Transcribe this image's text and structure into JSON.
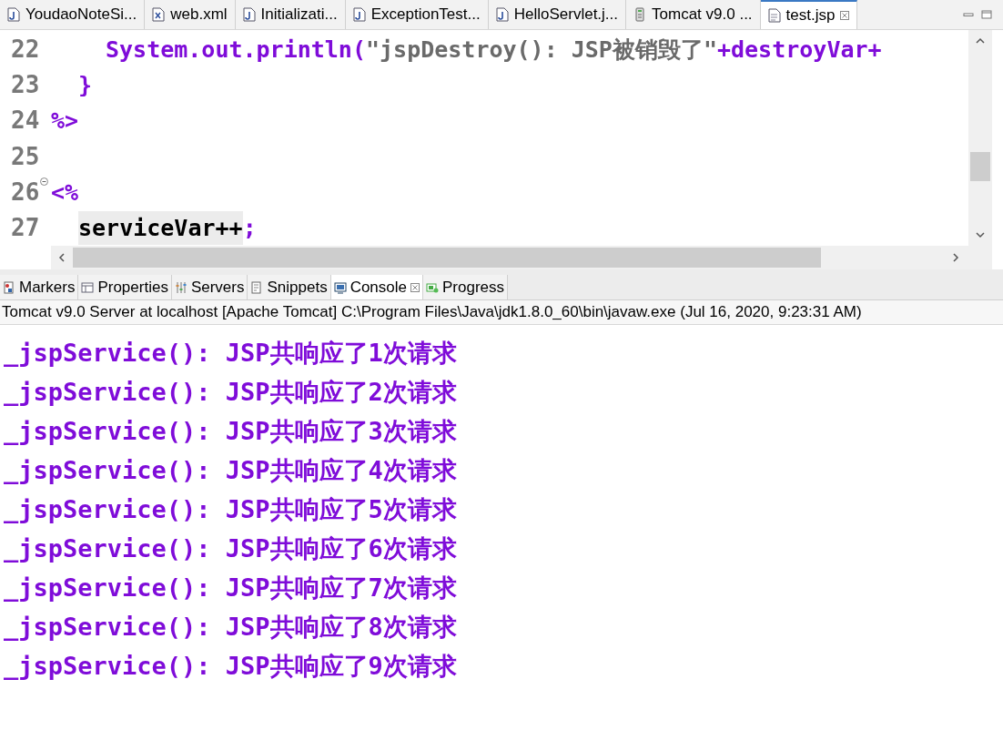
{
  "editor_tabs": [
    {
      "label": "YoudaoNoteSi...",
      "kind": "java",
      "selected": false
    },
    {
      "label": "web.xml",
      "kind": "xml",
      "selected": false
    },
    {
      "label": "Initializati...",
      "kind": "java",
      "selected": false
    },
    {
      "label": "ExceptionTest...",
      "kind": "java",
      "selected": false
    },
    {
      "label": "HelloServlet.j...",
      "kind": "java",
      "selected": false
    },
    {
      "label": "Tomcat v9.0 ...",
      "kind": "server",
      "selected": false
    },
    {
      "label": "test.jsp",
      "kind": "jsp",
      "selected": true
    }
  ],
  "code_lines": [
    {
      "number": "22",
      "fold": false,
      "kind": "nested",
      "segments": [
        {
          "text": "System.out.println(",
          "kind": "code"
        },
        {
          "text": "\"jspDestroy(): JSP被销毁了\"",
          "kind": "string"
        },
        {
          "text": "+destroyVar+",
          "kind": "code"
        }
      ]
    },
    {
      "number": "23",
      "fold": false,
      "kind": "block",
      "segments": [
        {
          "text": "}",
          "kind": "code"
        }
      ]
    },
    {
      "number": "24",
      "fold": false,
      "segments": [
        {
          "text": "%>",
          "kind": "code"
        }
      ]
    },
    {
      "number": "25",
      "fold": false
    },
    {
      "number": "26",
      "fold": true,
      "segments": [
        {
          "text": "<%",
          "kind": "code"
        }
      ]
    },
    {
      "number": "27",
      "fold": false,
      "kind": "block",
      "segments": [
        {
          "text": "serviceVar++",
          "kind": "variable"
        },
        {
          "text": ";",
          "kind": "code"
        }
      ]
    }
  ],
  "view_tabs": [
    {
      "label": "Markers",
      "kind": "markers",
      "selected": false
    },
    {
      "label": "Properties",
      "kind": "properties",
      "selected": false
    },
    {
      "label": "Servers",
      "kind": "servers",
      "selected": false
    },
    {
      "label": "Snippets",
      "kind": "snippets",
      "selected": false
    },
    {
      "label": "Console",
      "kind": "console",
      "selected": true
    },
    {
      "label": "Progress",
      "kind": "progress",
      "selected": false
    }
  ],
  "console": {
    "header": "Tomcat v9.0 Server at localhost [Apache Tomcat] C:\\Program Files\\Java\\jdk1.8.0_60\\bin\\javaw.exe (Jul 16, 2020, 9:23:31 AM)",
    "lines": [
      "_jspService(): JSP共响应了1次请求",
      "_jspService(): JSP共响应了2次请求",
      "_jspService(): JSP共响应了3次请求",
      "_jspService(): JSP共响应了4次请求",
      "_jspService(): JSP共响应了5次请求",
      "_jspService(): JSP共响应了6次请求",
      "_jspService(): JSP共响应了7次请求",
      "_jspService(): JSP共响应了8次请求",
      "_jspService(): JSP共响应了9次请求"
    ]
  }
}
